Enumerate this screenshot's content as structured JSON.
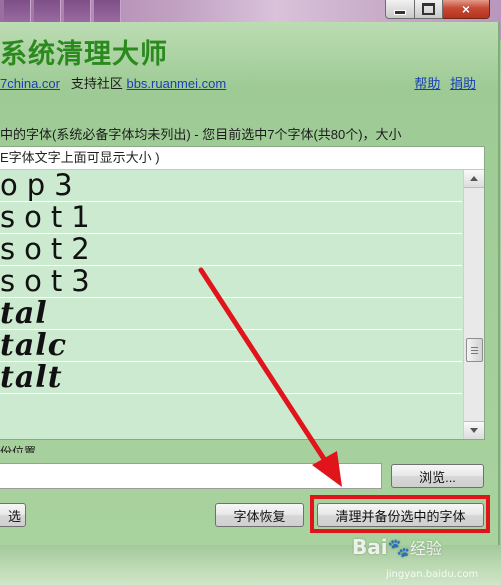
{
  "window": {
    "title": "系统清理大师",
    "controls": {
      "minimize": "minimize",
      "maximize": "maximize",
      "close": "×"
    }
  },
  "links": {
    "site": "7china.cor",
    "support_label": "支持社区",
    "support_url": "bbs.ruanmei.com",
    "help": "帮助",
    "donate": "捐助"
  },
  "description": "中的字体(系统必备字体均未列出) - 您目前选中7个字体(共80个)，大小",
  "font_list": {
    "header": "E字体文字上面可显示大小 )",
    "rows": [
      {
        "text": "op3",
        "style": "mono"
      },
      {
        "text": "sot1",
        "style": "mono"
      },
      {
        "text": "sot2",
        "style": "mono"
      },
      {
        "text": "sot3",
        "style": "mono"
      },
      {
        "text": "tal",
        "style": "ital"
      },
      {
        "text": "talc",
        "style": "ital"
      },
      {
        "text": "talt",
        "style": "ital"
      }
    ]
  },
  "backup": {
    "label": "份位置",
    "path_value": "",
    "browse_label": "浏览..."
  },
  "actions": {
    "select_all_label": "选",
    "restore_label": "字体恢复",
    "clean_label": "清理并备份选中的字体"
  },
  "watermark": {
    "brand": "Bai",
    "suffix": "经验",
    "url": "jingyan.baidu.com"
  },
  "colors": {
    "title_green": "#2a8a1d",
    "list_bg": "#cbeacf",
    "highlight_red": "#e0141a",
    "link_blue": "#1a3fb5"
  }
}
